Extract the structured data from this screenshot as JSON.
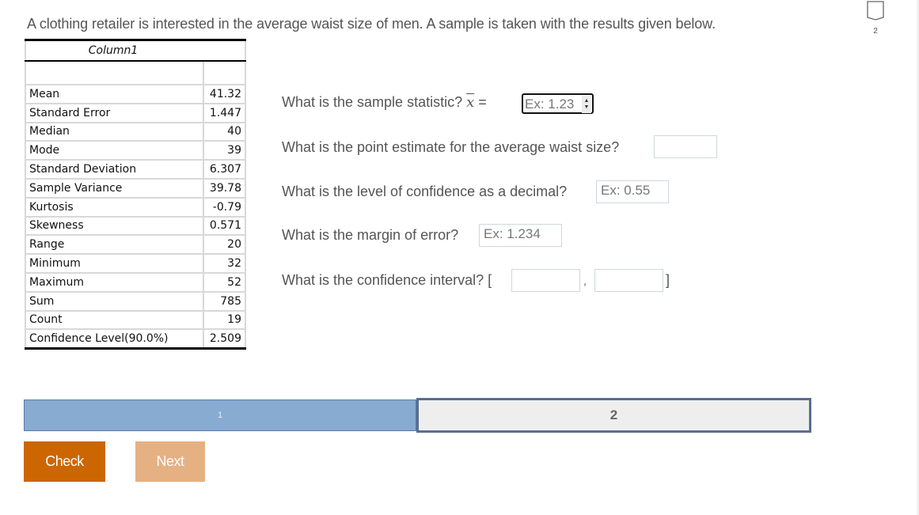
{
  "prompt": "A clothing retailer is interested in the average waist size of men. A sample is taken with the results given below.",
  "bookmark": {
    "icon": "bookmark-icon",
    "number": "2"
  },
  "table": {
    "header": "Column1",
    "rows": [
      {
        "label": "Mean",
        "value": "41.32"
      },
      {
        "label": "Standard Error",
        "value": "1.447"
      },
      {
        "label": "Median",
        "value": "40"
      },
      {
        "label": "Mode",
        "value": "39"
      },
      {
        "label": "Standard Deviation",
        "value": "6.307"
      },
      {
        "label": "Sample Variance",
        "value": "39.78"
      },
      {
        "label": "Kurtosis",
        "value": "-0.79"
      },
      {
        "label": "Skewness",
        "value": "0.571"
      },
      {
        "label": "Range",
        "value": "20"
      },
      {
        "label": "Minimum",
        "value": "32"
      },
      {
        "label": "Maximum",
        "value": "52"
      },
      {
        "label": "Sum",
        "value": "785"
      },
      {
        "label": "Count",
        "value": "19"
      },
      {
        "label": "Confidence Level(90.0%)",
        "value": "2.509"
      }
    ]
  },
  "questions": {
    "q1": {
      "text": "What is the sample statistic?",
      "math": "x",
      "equals": "=",
      "placeholder": "Ex: 1.23",
      "value": ""
    },
    "q2": {
      "text": "What is the point estimate for the average waist size?",
      "placeholder": "",
      "value": ""
    },
    "q3": {
      "text": "What is the level of confidence as a decimal?",
      "placeholder": "Ex: 0.55",
      "value": ""
    },
    "q4": {
      "text": "What is the margin of error?",
      "placeholder": "Ex: 1.234",
      "value": ""
    },
    "q5": {
      "text": "What is the confidence interval?",
      "open": "[",
      "sep": ",",
      "close": "]",
      "lower": "",
      "upper": ""
    }
  },
  "progress": {
    "parts": [
      "1",
      "2"
    ],
    "current": "2",
    "colors": {
      "done": "#87abd1",
      "current": "#eeeeee"
    }
  },
  "buttons": {
    "check": "Check",
    "next": "Next",
    "check_color": "#cc6600",
    "next_color": "#e5b183"
  }
}
